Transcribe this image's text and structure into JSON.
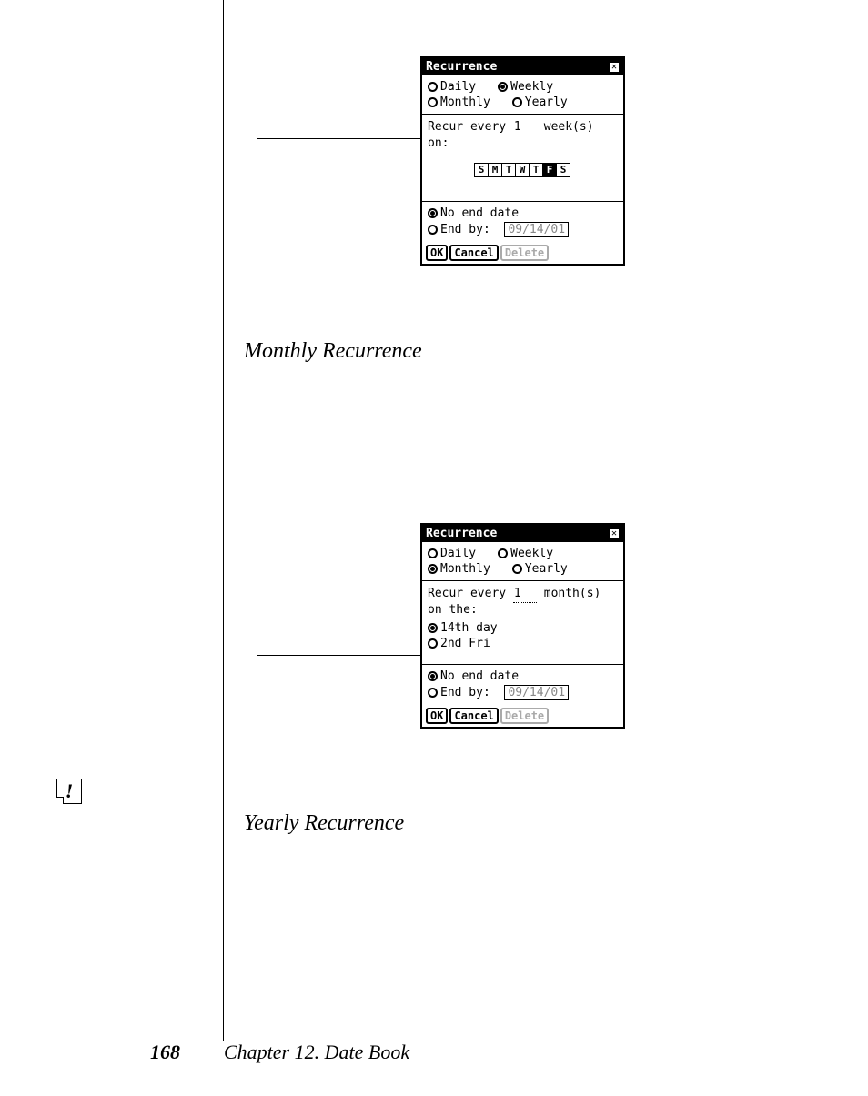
{
  "dialog1": {
    "title": "Recurrence",
    "close": "✕",
    "freq": {
      "daily": "Daily",
      "weekly": "Weekly",
      "monthly": "Monthly",
      "yearly": "Yearly"
    },
    "recur_prefix": "Recur every ",
    "recur_value": "1",
    "recur_suffix": " week(s) on:",
    "days": {
      "s1": "S",
      "m": "M",
      "t1": "T",
      "w": "W",
      "t2": "T",
      "f": "F",
      "s2": "S"
    },
    "no_end": "No end date",
    "end_by": "End by:",
    "end_date": "09/14/01",
    "ok": "OK",
    "cancel": "Cancel",
    "delete": "Delete"
  },
  "heading1": "Monthly Recurrence",
  "dialog2": {
    "title": "Recurrence",
    "close": "✕",
    "freq": {
      "daily": "Daily",
      "weekly": "Weekly",
      "monthly": "Monthly",
      "yearly": "Yearly"
    },
    "recur_prefix": "Recur every ",
    "recur_value": "1",
    "recur_suffix": " month(s) on the:",
    "opt1": "14th day",
    "opt2": "2nd Fri",
    "no_end": "No end date",
    "end_by": "End by:",
    "end_date": "09/14/01",
    "ok": "OK",
    "cancel": "Cancel",
    "delete": "Delete"
  },
  "heading2": "Yearly Recurrence",
  "footer": {
    "page": "168",
    "chapter": "Chapter 12. Date Book"
  }
}
